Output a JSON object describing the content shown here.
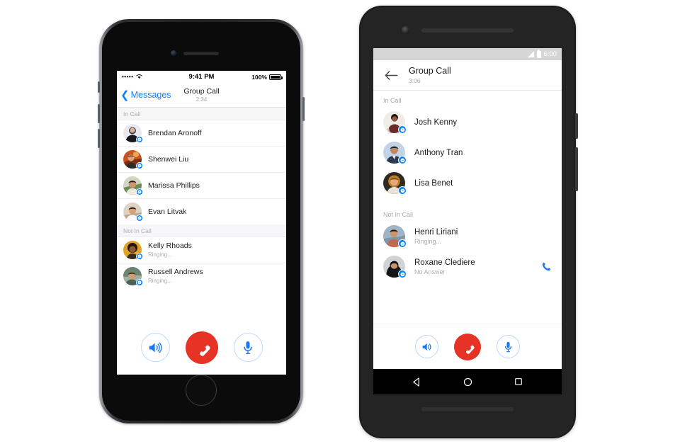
{
  "scene": {
    "description": "Facebook Messenger group call UI shown on an iPhone and an Android phone side by side"
  },
  "iphone": {
    "status_bar": {
      "carrier_dots": "•••••",
      "wifi_icon": "wifi-icon",
      "time": "9:41 PM",
      "battery_percent": "100%",
      "battery_icon": "battery-full-icon"
    },
    "nav": {
      "back_icon": "chevron-left-icon",
      "back_label": "Messages",
      "title": "Group Call",
      "duration": "2:34"
    },
    "sections": [
      {
        "header": "In Call",
        "rows": [
          {
            "name": "Brendan Aronoff",
            "status": "",
            "avatar": "avatar-brendan",
            "badge": "messenger-badge-icon"
          },
          {
            "name": "Shenwei Liu",
            "status": "",
            "avatar": "avatar-shenwei",
            "badge": "messenger-badge-icon"
          },
          {
            "name": "Marissa Phillips",
            "status": "",
            "avatar": "avatar-marissa",
            "badge": "messenger-badge-icon"
          },
          {
            "name": "Evan Litvak",
            "status": "",
            "avatar": "avatar-evan",
            "badge": "messenger-badge-icon"
          }
        ]
      },
      {
        "header": "Not In Call",
        "rows": [
          {
            "name": "Kelly Rhoads",
            "status": "Ringing...",
            "avatar": "avatar-kelly",
            "badge": "messenger-badge-icon"
          },
          {
            "name": "Russell Andrews",
            "status": "Ringing...",
            "avatar": "avatar-russell",
            "badge": "messenger-badge-icon"
          }
        ]
      }
    ],
    "controls": [
      {
        "name": "speaker-button",
        "icon": "speaker-icon",
        "style": "outline"
      },
      {
        "name": "end-call-button",
        "icon": "hangup-icon",
        "style": "danger"
      },
      {
        "name": "mute-button",
        "icon": "microphone-icon",
        "style": "outline"
      }
    ],
    "home_button": "home-button"
  },
  "android": {
    "status_bar": {
      "signal_icon": "signal-icon",
      "battery_icon": "battery-icon",
      "time": "6:00"
    },
    "appbar": {
      "back_icon": "arrow-left-icon",
      "title": "Group Call",
      "duration": "3:06"
    },
    "sections": [
      {
        "header": "In Call",
        "rows": [
          {
            "name": "Josh Kenny",
            "status": "",
            "avatar": "avatar-josh",
            "badge": "messenger-badge-icon",
            "action": ""
          },
          {
            "name": "Anthony Tran",
            "status": "",
            "avatar": "avatar-anthony",
            "badge": "messenger-badge-icon",
            "action": ""
          },
          {
            "name": "Lisa Benet",
            "status": "",
            "avatar": "avatar-lisa",
            "badge": "messenger-badge-icon",
            "action": ""
          }
        ]
      },
      {
        "header": "Not In Call",
        "rows": [
          {
            "name": "Henri Liriani",
            "status": "Ringing...",
            "avatar": "avatar-henri",
            "badge": "messenger-badge-icon",
            "action": ""
          },
          {
            "name": "Roxane Clediere",
            "status": "No Answer",
            "avatar": "avatar-roxane",
            "badge": "messenger-badge-icon",
            "action": "phone-call-icon"
          }
        ]
      }
    ],
    "controls": [
      {
        "name": "speaker-button",
        "icon": "speaker-icon",
        "style": "outline"
      },
      {
        "name": "end-call-button",
        "icon": "hangup-icon",
        "style": "danger"
      },
      {
        "name": "mute-button",
        "icon": "microphone-icon",
        "style": "outline"
      }
    ],
    "navbar": [
      {
        "name": "android-back-button",
        "icon": "triangle-back-icon"
      },
      {
        "name": "android-home-button",
        "icon": "circle-home-icon"
      },
      {
        "name": "android-recents-button",
        "icon": "square-recents-icon"
      }
    ]
  },
  "colors": {
    "messenger_blue": "#0084ff",
    "ios_link_blue": "#1283ff",
    "end_call_red": "#e63325",
    "section_header_gray": "#adadb3",
    "status_text_gray": "#b0b0b6",
    "android_status_bar": "#d6d6d6"
  }
}
